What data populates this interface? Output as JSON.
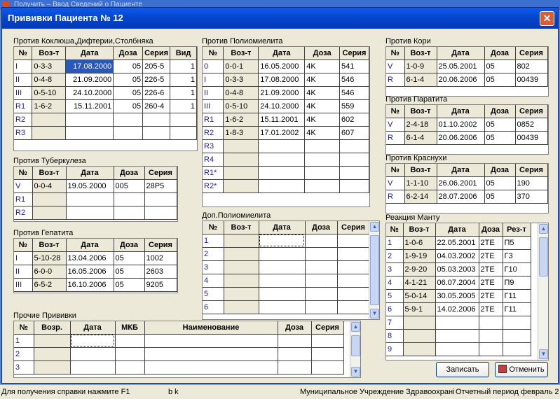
{
  "parent_window": {
    "title": "Получить – Ввод Сведений о Пациенте"
  },
  "dialog": {
    "title": "Прививки Пациента № 12",
    "close": "✕"
  },
  "pertussis": {
    "label": "Против Коклюша,Дифтерии,Столбняка",
    "headers": [
      "№",
      "Воз-т",
      "Дата",
      "Доза",
      "Серия",
      "Вид"
    ],
    "rows": [
      [
        "I",
        "0-3-3",
        "17.08.2000",
        "05",
        "205-5",
        "1"
      ],
      [
        "II",
        "0-4-8",
        "21.09.2000",
        "05",
        "226-5",
        "1"
      ],
      [
        "III",
        "0-5-10",
        "24.10.2000",
        "05",
        "226-6",
        "1"
      ],
      [
        "R1",
        "1-6-2",
        "15.11.2001",
        "05",
        "260-4",
        "1"
      ],
      [
        "R2",
        "",
        "",
        "",
        "",
        ""
      ],
      [
        "R3",
        "",
        "",
        "",
        "",
        ""
      ]
    ]
  },
  "tuberculosis": {
    "label": "Против Туберкулеза",
    "headers": [
      "№",
      "Воз-т",
      "Дата",
      "Доза",
      "Серия"
    ],
    "rows": [
      [
        "V",
        "0-0-4",
        "19.05.2000",
        "005",
        "28P5"
      ],
      [
        "R1",
        "",
        "",
        "",
        ""
      ],
      [
        "R2",
        "",
        "",
        "",
        ""
      ]
    ]
  },
  "hepatitis": {
    "label": "Против Гепатита",
    "headers": [
      "№",
      "Воз-т",
      "Дата",
      "Доза",
      "Серия"
    ],
    "rows": [
      [
        "I",
        "5-10-28",
        "13.04.2006",
        "05",
        "1002"
      ],
      [
        "II",
        "6-0-0",
        "16.05.2006",
        "05",
        "2603"
      ],
      [
        "III",
        "6-5-2",
        "16.10.2006",
        "05",
        "9205"
      ]
    ]
  },
  "polio": {
    "label": "Против Полиомиелита",
    "headers": [
      "№",
      "Воз-т",
      "Дата",
      "Доза",
      "Серия"
    ],
    "rows": [
      [
        "0",
        "0-0-1",
        "16.05.2000",
        "4K",
        "541"
      ],
      [
        "I",
        "0-3-3",
        "17.08.2000",
        "4K",
        "546"
      ],
      [
        "II",
        "0-4-8",
        "21.09.2000",
        "4K",
        "546"
      ],
      [
        "III",
        "0-5-10",
        "24.10.2000",
        "4K",
        "559"
      ],
      [
        "R1",
        "1-6-2",
        "15.11.2001",
        "4K",
        "602"
      ],
      [
        "R2",
        "1-8-3",
        "17.01.2002",
        "4K",
        "607"
      ],
      [
        "R3",
        "",
        "",
        "",
        ""
      ],
      [
        "R4",
        "",
        "",
        "",
        ""
      ],
      [
        "R1*",
        "",
        "",
        "",
        ""
      ],
      [
        "R2*",
        "",
        "",
        "",
        ""
      ]
    ]
  },
  "polio_extra": {
    "label": "Доп.Полиомиелита",
    "headers": [
      "№",
      "Воз-т",
      "Дата",
      "Доза",
      "Серия"
    ],
    "rows": [
      [
        "1",
        "",
        "",
        "",
        ""
      ],
      [
        "2",
        "",
        "",
        "",
        ""
      ],
      [
        "3",
        "",
        "",
        "",
        ""
      ],
      [
        "4",
        "",
        "",
        "",
        ""
      ],
      [
        "5",
        "",
        "",
        "",
        ""
      ],
      [
        "6",
        "",
        "",
        "",
        ""
      ]
    ]
  },
  "measles": {
    "label": "Против Кори",
    "headers": [
      "№",
      "Воз-т",
      "Дата",
      "Доза",
      "Серия"
    ],
    "rows": [
      [
        "V",
        "1-0-9",
        "25.05.2001",
        "05",
        "802"
      ],
      [
        "R",
        "6-1-4",
        "20.06.2006",
        "05",
        "00439"
      ]
    ]
  },
  "mumps": {
    "label": "Против Паратита",
    "headers": [
      "№",
      "Воз-т",
      "Дата",
      "Доза",
      "Серия"
    ],
    "rows": [
      [
        "V",
        "2-4-18",
        "01.10.2002",
        "05",
        "0852"
      ],
      [
        "R",
        "6-1-4",
        "20.06.2006",
        "05",
        "00439"
      ]
    ]
  },
  "rubella": {
    "label": "Против Краснухи",
    "headers": [
      "№",
      "Воз-т",
      "Дата",
      "Доза",
      "Серия"
    ],
    "rows": [
      [
        "V",
        "1-1-10",
        "26.06.2001",
        "05",
        "190"
      ],
      [
        "R",
        "6-2-14",
        "28.07.2006",
        "05",
        "370"
      ]
    ]
  },
  "mantoux": {
    "label": "Реакция Манту",
    "headers": [
      "№",
      "Воз-т",
      "Дата",
      "Доза",
      "Рез-т"
    ],
    "rows": [
      [
        "1",
        "1-0-6",
        "22.05.2001",
        "2TE",
        "П5"
      ],
      [
        "2",
        "1-9-19",
        "04.03.2002",
        "2TE",
        "Г3"
      ],
      [
        "3",
        "2-9-20",
        "05.03.2003",
        "2TE",
        "Г10"
      ],
      [
        "4",
        "4-1-21",
        "06.07.2004",
        "2TE",
        "П9"
      ],
      [
        "5",
        "5-0-14",
        "30.05.2005",
        "2TE",
        "Г11"
      ],
      [
        "6",
        "5-9-1",
        "14.02.2006",
        "2TE",
        "Г11"
      ],
      [
        "7",
        "",
        "",
        "",
        ""
      ],
      [
        "8",
        "",
        "",
        "",
        ""
      ],
      [
        "9",
        "",
        "",
        "",
        ""
      ]
    ]
  },
  "other": {
    "label": "Прочие Прививки",
    "headers": [
      "№",
      "Возр.",
      "Дата",
      "МКБ",
      "Наименование",
      "Доза",
      "Серия"
    ],
    "rows": [
      [
        "1",
        "",
        "",
        "",
        "",
        "",
        ""
      ],
      [
        "2",
        "",
        "",
        "",
        "",
        "",
        ""
      ],
      [
        "3",
        "",
        "",
        "",
        "",
        "",
        ""
      ]
    ]
  },
  "buttons": {
    "save": "Записать",
    "cancel": "Отменить"
  },
  "status": {
    "help": "Для получения справки нажмите F1",
    "mid": "b k",
    "org": "Муниципальное Учреждение Здравоохрані",
    "period": "Отчетный период февраль 2"
  },
  "icons": [
    "close-icon",
    "scroll-up-icon",
    "scroll-down-icon",
    "cancel-icon",
    "app-icon"
  ]
}
